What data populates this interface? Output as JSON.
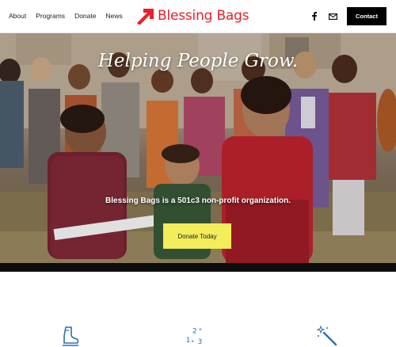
{
  "header": {
    "nav": [
      "About",
      "Programs",
      "Donate",
      "News"
    ],
    "brand": "Blessing Bags",
    "contact_label": "Contact",
    "social": [
      "facebook-icon",
      "mail-icon"
    ]
  },
  "hero": {
    "title": "Helping People Grow.",
    "subtitle": "Blessing Bags is a 501c3 non-profit organization.",
    "cta_label": "Donate Today"
  },
  "features": {
    "icons": [
      "boot-icon",
      "numbers-icon",
      "magic-wand-icon"
    ]
  },
  "colors": {
    "brand_red": "#e8202a",
    "cta_yellow": "#f3ec5b",
    "icon_blue": "#2f6fb5",
    "dark": "#000000"
  }
}
